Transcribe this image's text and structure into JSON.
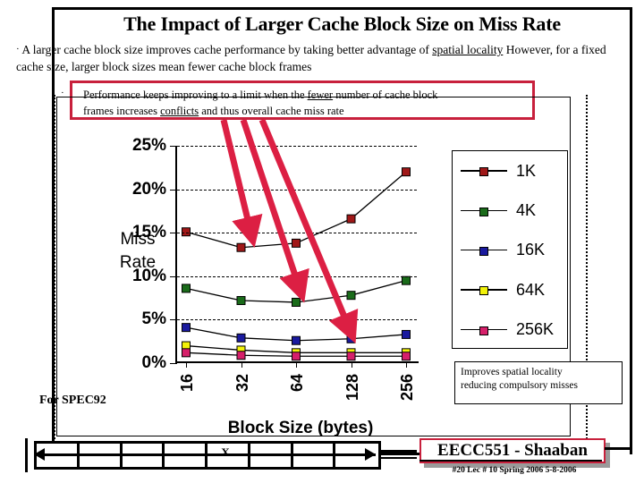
{
  "slide": {
    "title": "The Impact of Larger Cache Block Size on Miss Rate",
    "bullet_marker": "·",
    "bullet_text_1": "A larger cache block size improves cache performance by taking better advantage of ",
    "bullet_underline_1": "spatial locality",
    "bullet_text_2": " However, for a fixed cache size, larger block sizes mean fewer cache block frames",
    "callout_bullet": "·",
    "callout_line1_a": "Performance keeps improving to a limit  when  the ",
    "callout_line1_u": "fewer",
    "callout_line1_b": " number of cache block",
    "callout_line2_a": "frames increases ",
    "callout_line2_u": "conflicts",
    "callout_line2_b": " and  thus overall cache miss rate",
    "callout_border_color": "#c8203c",
    "note_box_line1": "Improves spatial locality",
    "note_box_line2": "reducing compulsory misses",
    "spec_note": "For SPEC92",
    "strip_x_label": "X"
  },
  "footer": {
    "badge": "EECC551 - Shaaban",
    "meta": "#20   Lec # 10   Spring 2006  5-8-2006",
    "badge_color": "#c8203c"
  },
  "chart_data": {
    "type": "line",
    "title": "",
    "xlabel": "Block Size (bytes)",
    "ylabel": "Miss Rate",
    "ylabel_lines": [
      "Miss",
      "Rate"
    ],
    "categories": [
      "16",
      "32",
      "64",
      "128",
      "256"
    ],
    "ylim": [
      0,
      25
    ],
    "yticks": [
      0,
      5,
      10,
      15,
      20,
      25
    ],
    "ytick_labels": [
      "0%",
      "5%",
      "10%",
      "15%",
      "20%",
      "25%"
    ],
    "grid": true,
    "legend_position": "right",
    "series": [
      {
        "name": "1K",
        "color": "#a01818",
        "values": [
          15.1,
          13.3,
          13.8,
          16.6,
          22.0
        ]
      },
      {
        "name": "4K",
        "color": "#1a6b1a",
        "values": [
          8.6,
          7.2,
          7.0,
          7.8,
          9.5
        ]
      },
      {
        "name": "16K",
        "color": "#1a1a9e",
        "values": [
          4.1,
          2.9,
          2.6,
          2.8,
          3.3
        ]
      },
      {
        "name": "64K",
        "color": "#f2f20a",
        "values": [
          2.0,
          1.5,
          1.2,
          1.2,
          1.2
        ]
      },
      {
        "name": "256K",
        "color": "#d6206a",
        "values": [
          1.2,
          0.9,
          0.8,
          0.8,
          0.8
        ]
      }
    ],
    "annotations": {
      "arrow_color": "#dc1f43",
      "arrows": [
        {
          "label": "arrow-to-1K-32"
        },
        {
          "label": "arrow-to-4K-64"
        },
        {
          "label": "arrow-to-16K-128"
        }
      ]
    }
  }
}
